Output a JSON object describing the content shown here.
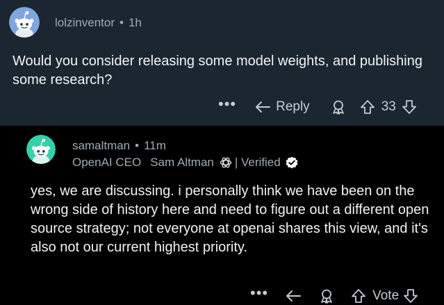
{
  "top_comment": {
    "username": "lolzinventor",
    "separator": "•",
    "time": "1h",
    "body": "Would you consider releasing some model weights, and publishing some research?",
    "more_label": "•••",
    "reply_label": "Reply",
    "vote_count": "33",
    "avatar_color": "#7fa6e0"
  },
  "reply_comment": {
    "username": "samaltman",
    "separator": "•",
    "time": "11m",
    "flair_title": "OpenAI CEO",
    "flair_name": "Sam Altman",
    "flair_verified": "| Verified",
    "body": "yes, we are discussing. i personally think we have been on the wrong side of history here and need to figure out a different open source strategy; not everyone at openai shares this view, and it's also not our current highest priority.",
    "more_label": "•••",
    "vote_label": "Vote",
    "avatar_color": "#33d1a8"
  },
  "colors": {
    "top_background": "#1b2631",
    "reply_background": "#000000",
    "meta_text": "#a2aab3",
    "body_text": "#f1f3f5",
    "action_text": "#c6ccd2"
  }
}
